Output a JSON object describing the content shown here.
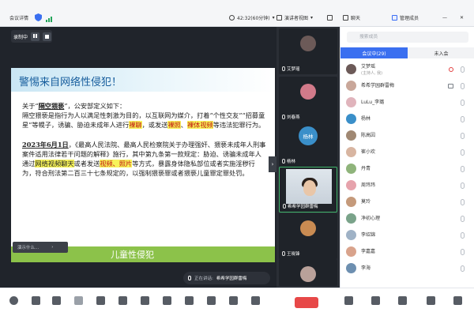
{
  "topbar": {
    "meeting_details": "会议详情",
    "clock": "42:32(60分钟)",
    "view_label": "演讲者视图",
    "chat_label": "聊天",
    "members_label": "管理成员"
  },
  "recording": {
    "label": "录制中"
  },
  "slide": {
    "title": "警惕来自网络性侵犯！",
    "p1_a": "关于“",
    "p1_term": "隔空猥亵",
    "p1_b": "”，公安部定义如下：",
    "p1_c": "隔空猥亵是指行为人以满足性刺激为目的，以互联网为媒介，打着“个性交友”“招募童星”等幌子，诱骗、胁迫未成年人进行",
    "p1_hl1": "裸聊",
    "p1_d": "，或发送",
    "p1_hl2": "裸照",
    "p1_e": "、",
    "p1_hl3": "裸体视频",
    "p1_f": "等违法犯罪行为。",
    "p2_date": "2023年6月1日",
    "p2_a": "，《最高人民法院、最高人民检察院关于办理强奸、猥亵未成年人刑事案件适用法律若干问题的解释》施行，其中第九条第一款规定：胁迫、诱骗未成年人通过",
    "p2_hl1": "网络视频聊天",
    "p2_b": "或者发送",
    "p2_hl2": "视频、照片",
    "p2_c": "等方式，暴露身体隐私部位或者实施淫秽行为，符合刑法第二百三十七条规定的，以强制猥亵罪或者猥亵儿童罪定罪处罚。",
    "footer": "儿童性侵犯",
    "ctl_left": "演示什么..."
  },
  "speaking": {
    "label": "正在讲话:",
    "name": "希希学园群雷梅"
  },
  "videos": [
    {
      "name": "艾梦瑶",
      "color": "#6c5a58"
    },
    {
      "name": "刘春燕",
      "color": "#d27a8a"
    },
    {
      "name": "杨林",
      "initials": "杨林",
      "color": "#3a8fc9"
    },
    {
      "name": "希希学园群雷梅"
    },
    {
      "name": "王晓锋",
      "color": "#c98b52"
    },
    {
      "name": "",
      "color": "#b9a19a"
    }
  ],
  "panel": {
    "search_placeholder": "搜索成员",
    "tab_in": "会议中(29)",
    "tab_out": "未入会",
    "members": [
      {
        "name": "艾梦瑶",
        "sub": "(主持人, 我)",
        "color": "#6c5a58"
      },
      {
        "name": "希希学园群雷梅",
        "color": "#c9a79a"
      },
      {
        "name": "LuLu_李璐",
        "color": "#e0b4bc"
      },
      {
        "name": "杨林",
        "color": "#3a8fc9"
      },
      {
        "name": "陈高因",
        "color": "#a08873"
      },
      {
        "name": "崔小欢",
        "color": "#d8b5a1"
      },
      {
        "name": "丹青",
        "color": "#8fb47b"
      },
      {
        "name": "周玮玮",
        "color": "#e6a3ac"
      },
      {
        "name": "莫玲",
        "color": "#c59a7b"
      },
      {
        "name": "净初心理",
        "color": "#7aa38a"
      },
      {
        "name": "李绍锦",
        "color": "#9fb2c6"
      },
      {
        "name": "李嘉嘉",
        "color": "#d9a38c"
      },
      {
        "name": "李海",
        "color": "#6d8fb0"
      }
    ]
  },
  "colors": {
    "accent": "#3a6ff0",
    "end_call": "#e74848",
    "speaker_border": "#3fb56a"
  }
}
